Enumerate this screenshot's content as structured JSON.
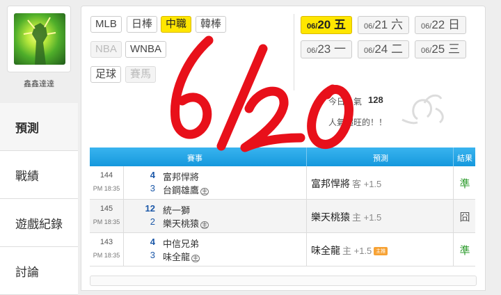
{
  "user": {
    "name": "鑫鑫達達"
  },
  "nav": [
    {
      "label": "預測",
      "active": true
    },
    {
      "label": "戰績",
      "active": false
    },
    {
      "label": "遊戲紀錄",
      "active": false
    },
    {
      "label": "討論",
      "active": false
    }
  ],
  "leagues": [
    {
      "label": "MLB",
      "state": "normal"
    },
    {
      "label": "日棒",
      "state": "normal"
    },
    {
      "label": "中職",
      "state": "active"
    },
    {
      "label": "韓棒",
      "state": "normal"
    },
    {
      "label": "NBA",
      "state": "disabled"
    },
    {
      "label": "WNBA",
      "state": "normal"
    },
    {
      "label": "足球",
      "state": "normal"
    },
    {
      "label": "賽馬",
      "state": "disabled"
    }
  ],
  "dates": [
    {
      "md": "06/",
      "d": "20",
      "wd": "五",
      "active": true
    },
    {
      "md": "06/",
      "d": "21",
      "wd": "六",
      "active": false
    },
    {
      "md": "06/",
      "d": "22",
      "wd": "日",
      "active": false
    },
    {
      "md": "06/",
      "d": "23",
      "wd": "一",
      "active": false
    },
    {
      "md": "06/",
      "d": "24",
      "wd": "二",
      "active": false
    },
    {
      "md": "06/",
      "d": "25",
      "wd": "三",
      "active": false
    }
  ],
  "popularity": {
    "label": "今日人氣",
    "value": "128",
    "message": "人氣超旺的！！"
  },
  "table": {
    "headers": {
      "games": "賽事",
      "prediction": "預測",
      "result": "結果"
    },
    "rows": [
      {
        "num": "144",
        "time": "PM 18:35",
        "away_score": "4",
        "away_team": "富邦悍將",
        "home_score": "3",
        "home_team": "台鋼雄鷹",
        "home_mark": "主",
        "pred_team": "富邦悍將",
        "pred_side": "客 +1.5",
        "pred_badge": "",
        "result": "準"
      },
      {
        "num": "145",
        "time": "PM 18:35",
        "away_score": "12",
        "away_team": "統一獅",
        "home_score": "2",
        "home_team": "樂天桃猿",
        "home_mark": "主",
        "pred_team": "樂天桃猿",
        "pred_side": "主 +1.5",
        "pred_badge": "",
        "result": "囧"
      },
      {
        "num": "143",
        "time": "PM 18:35",
        "away_score": "4",
        "away_team": "中信兄弟",
        "home_score": "3",
        "home_team": "味全龍",
        "home_mark": "主",
        "pred_team": "味全龍",
        "pred_side": "主 +1.5",
        "pred_badge": "主推",
        "result": "準"
      }
    ]
  },
  "colors": {
    "accent": "#ffe600",
    "header_blue": "#1598dd",
    "win_green": "#2a9a2a",
    "handwriting_red": "#e8101a"
  }
}
